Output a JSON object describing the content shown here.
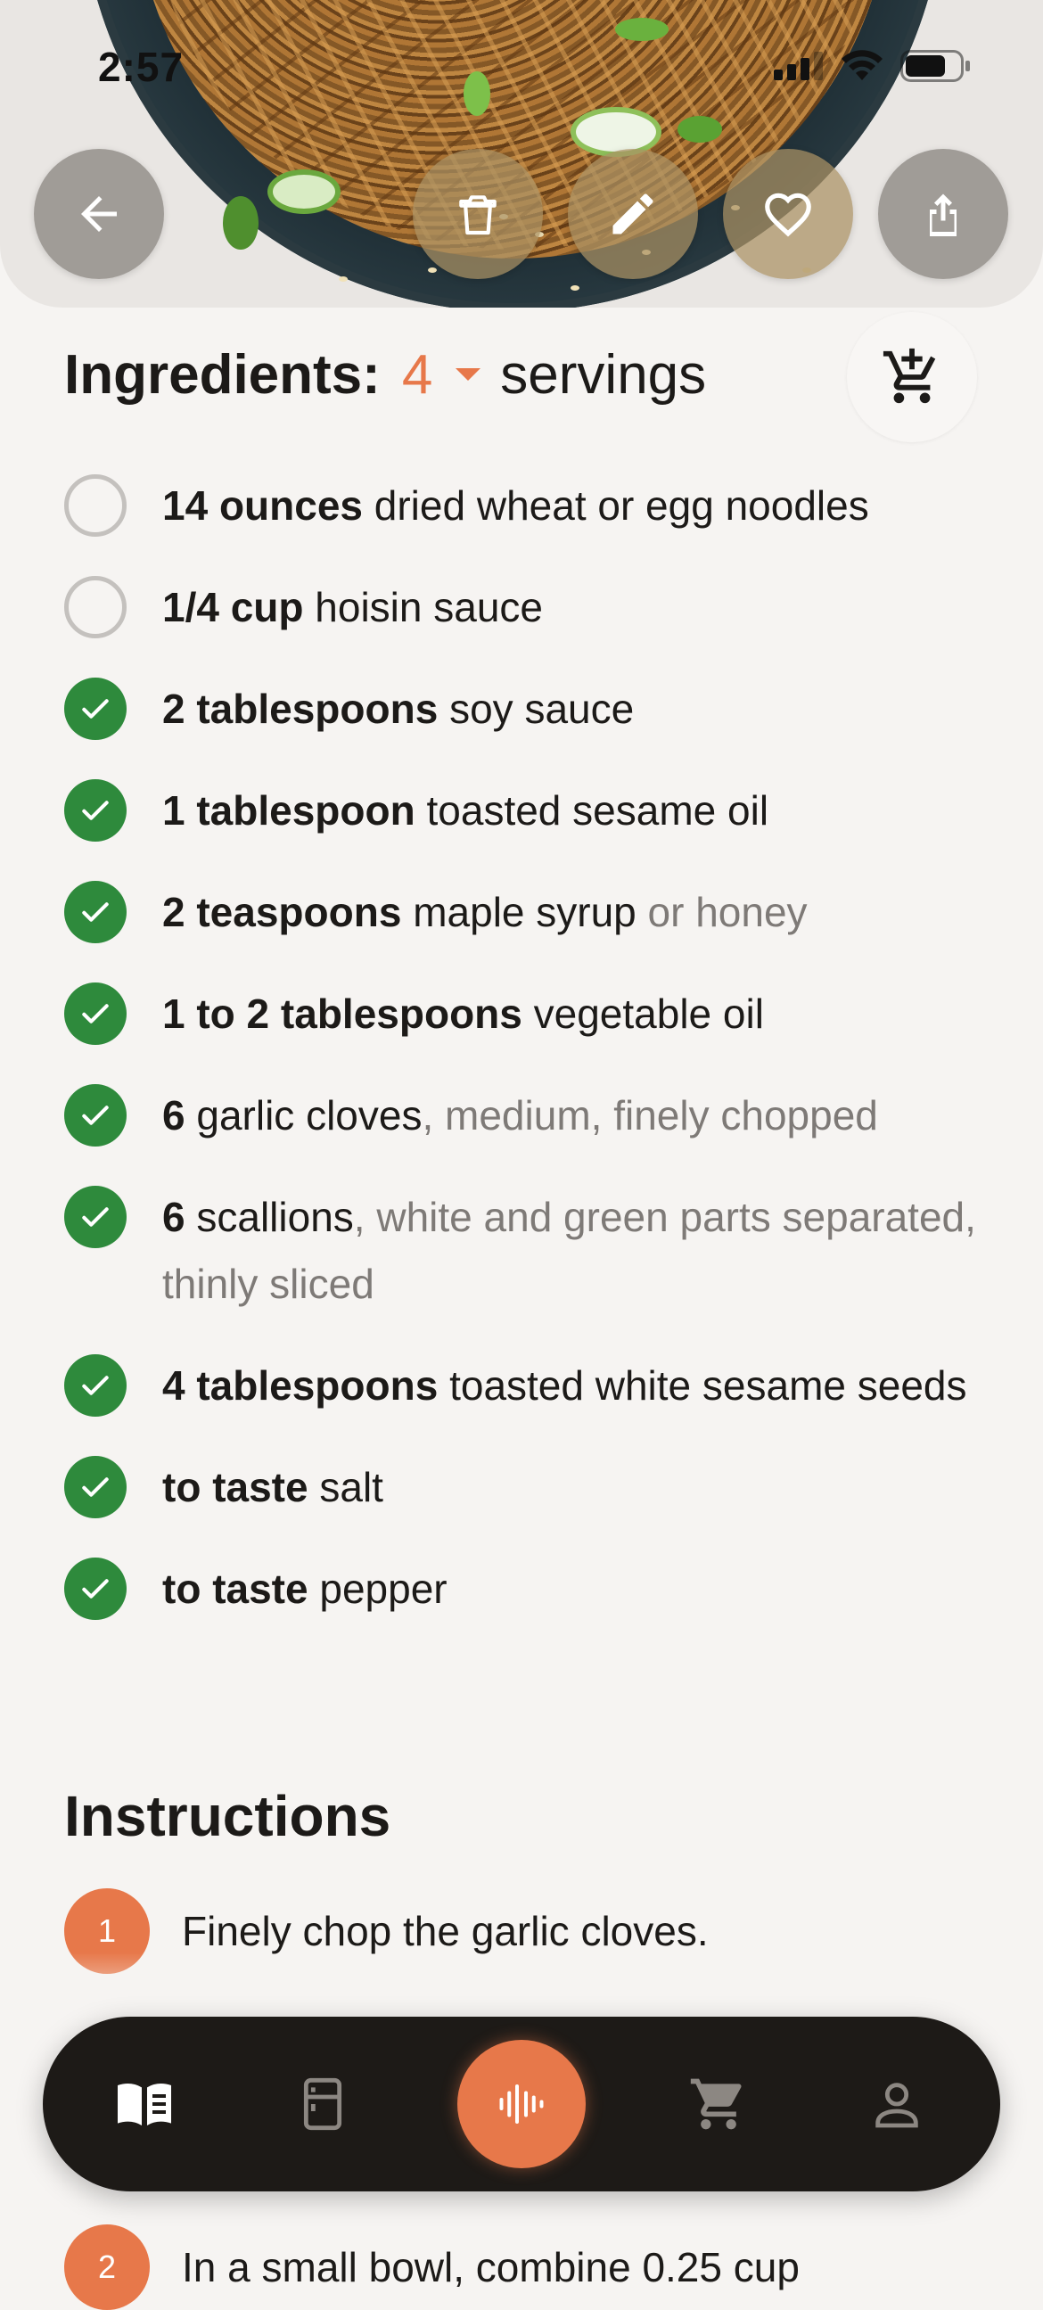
{
  "status_bar": {
    "time": "2:57"
  },
  "hero": {
    "icons": [
      "arrow-left-icon",
      "trash-icon",
      "pencil-icon",
      "heart-icon",
      "share-icon"
    ]
  },
  "ingredients": {
    "title": "Ingredients:",
    "servings_value": "4",
    "servings_label": "servings",
    "add_to_cart_icon": "cart-plus-icon",
    "items": [
      {
        "amount": "14 ounces",
        "name": "dried wheat or egg noodles",
        "note": "",
        "checked": false
      },
      {
        "amount": "1/4 cup",
        "name": "hoisin sauce",
        "note": "",
        "checked": false
      },
      {
        "amount": "2 tablespoons",
        "name": "soy sauce",
        "note": "",
        "checked": true
      },
      {
        "amount": "1 tablespoon",
        "name": "toasted sesame oil",
        "note": "",
        "checked": true
      },
      {
        "amount": "2 teaspoons",
        "name": "maple syrup",
        "note": " or honey",
        "checked": true
      },
      {
        "amount": "1 to 2 tablespoons",
        "name": "vegetable oil",
        "note": "",
        "checked": true
      },
      {
        "amount": "6",
        "name": "garlic cloves",
        "note": ", medium, finely chopped",
        "checked": true
      },
      {
        "amount": "6",
        "name": "scallions",
        "note": ", white and green parts separated, thinly sliced",
        "checked": true
      },
      {
        "amount": "4 tablespoons",
        "name": "toasted white sesame seeds",
        "note": "",
        "checked": true
      },
      {
        "amount": "to taste",
        "name": "salt",
        "note": "",
        "checked": true
      },
      {
        "amount": "to taste",
        "name": "pepper",
        "note": "",
        "checked": true
      }
    ]
  },
  "instructions": {
    "title": "Instructions",
    "steps": [
      {
        "num": "1",
        "text": "Finely chop the garlic cloves."
      },
      {
        "num": "2",
        "text": "In a small bowl, combine 0.25 cup"
      }
    ]
  },
  "bottom_nav": {
    "items": [
      "book-open-icon",
      "fridge-icon",
      "voice-waveform-icon",
      "cart-icon",
      "person-icon"
    ],
    "active": "book-open-icon",
    "accent": "#e7784a"
  },
  "colors": {
    "accent": "#e7784a",
    "check_green": "#2e8a3c",
    "background": "#f6f4f2",
    "nav_bg": "#1d1a17"
  }
}
